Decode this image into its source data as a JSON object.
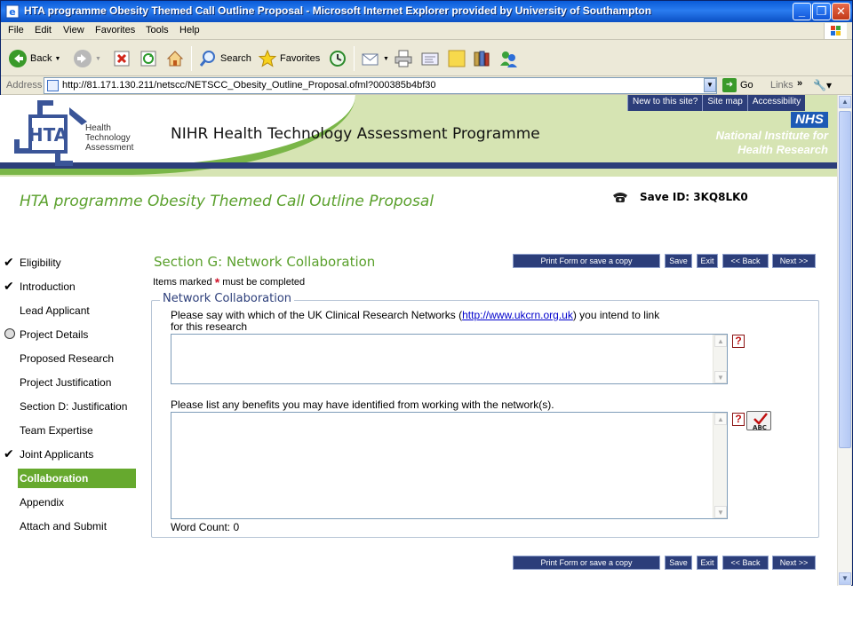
{
  "window": {
    "title": "HTA programme Obesity Themed Call Outline Proposal - Microsoft Internet Explorer provided by University of Southampton",
    "minimize_glyph": "_",
    "maximize_glyph": "❐",
    "close_glyph": "✕"
  },
  "menu": [
    "File",
    "Edit",
    "View",
    "Favorites",
    "Tools",
    "Help"
  ],
  "toolbar": {
    "back_label": "Back",
    "search_label": "Search",
    "favorites_label": "Favorites"
  },
  "address": {
    "label": "Address",
    "url": "http://81.171.130.211/netscc/NETSCC_Obesity_Outline_Proposal.ofml?000385b4bf30",
    "go_label": "Go",
    "links_label": "Links"
  },
  "header": {
    "logo_text": "HTA",
    "logo_name_lines": [
      "Health",
      "Technology",
      "Assessment"
    ],
    "programme_title": "NIHR Health Technology Assessment Programme",
    "top_links": [
      "New to this site?",
      "Site map",
      "Accessibility"
    ],
    "nhs_badge": "NHS",
    "nihr_lines": [
      "National Institute for",
      "Health Research"
    ]
  },
  "form": {
    "title": "HTA programme Obesity Themed Call Outline Proposal",
    "save_id_label": "Save ID: 3KQ8LK0"
  },
  "nav": {
    "items": [
      {
        "label": "Eligibility",
        "status": "done"
      },
      {
        "label": "Introduction",
        "status": "done"
      },
      {
        "label": "Lead Applicant",
        "status": "none"
      },
      {
        "label": "Project Details",
        "status": "partial"
      },
      {
        "label": "Proposed Research",
        "status": "none"
      },
      {
        "label": "Project Justification",
        "status": "none"
      },
      {
        "label": "Section D: Justification",
        "status": "none"
      },
      {
        "label": "Team Expertise",
        "status": "none"
      },
      {
        "label": "Joint Applicants",
        "status": "done"
      },
      {
        "label": "Collaboration",
        "status": "active"
      },
      {
        "label": "Appendix",
        "status": "none"
      },
      {
        "label": "Attach and Submit",
        "status": "none"
      }
    ],
    "check_glyph": "✔"
  },
  "section": {
    "title": "Section G: Network Collaboration",
    "required_note_pre": "Items marked",
    "required_star": "*",
    "required_note_post": "must be completed",
    "fieldset_legend": "Network Collaboration",
    "q1_pre": "Please say with which of the UK Clinical Research Networks (",
    "q1_link": "http://www.ukcrn.org.uk",
    "q1_post": ") you intend to link",
    "q1_line2": "for this research",
    "q2": "Please list any benefits you may have identified from working with the network(s).",
    "answer1": "",
    "answer2": "",
    "help_glyph": "?",
    "spell_glyph": "ABC",
    "word_count": "Word Count: 0"
  },
  "buttons": {
    "print": "Print Form or save a copy",
    "save": "Save",
    "exit": "Exit",
    "back": "<< Back",
    "next": "Next >>"
  },
  "colors": {
    "accent_green": "#5aa02c",
    "nav_active": "#66a92e",
    "navy": "#2c3e7a",
    "banner_green": "#d6e4b3"
  }
}
